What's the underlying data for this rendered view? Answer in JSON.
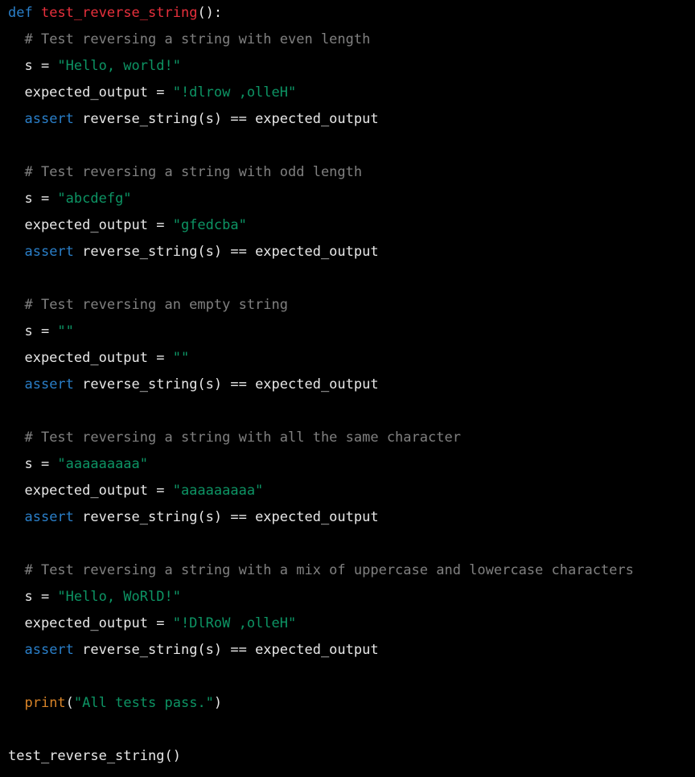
{
  "editor": {
    "language": "python",
    "background_color": "#000000",
    "default_text_color": "#e8e8e8",
    "theme_colors": {
      "keyword": "#2a7fc9",
      "function_name": "#e8303c",
      "string": "#0d9464",
      "comment": "#808080",
      "builtin": "#d98428",
      "plain": "#e8e8e8"
    }
  },
  "code": {
    "lines": [
      {
        "id": "line-1",
        "blank": false,
        "tokens": [
          {
            "t": "def",
            "k": "keyword"
          },
          {
            "t": " ",
            "k": "plain"
          },
          {
            "t": "test_reverse_string",
            "k": "funcname"
          },
          {
            "t": "():",
            "k": "punct"
          }
        ]
      },
      {
        "id": "line-2",
        "blank": false,
        "tokens": [
          {
            "t": "  ",
            "k": "plain"
          },
          {
            "t": "# Test reversing a string with even length",
            "k": "comment"
          }
        ]
      },
      {
        "id": "line-3",
        "blank": false,
        "tokens": [
          {
            "t": "  s = ",
            "k": "plain"
          },
          {
            "t": "\"Hello, world!\"",
            "k": "string"
          }
        ]
      },
      {
        "id": "line-4",
        "blank": false,
        "tokens": [
          {
            "t": "  expected_output = ",
            "k": "plain"
          },
          {
            "t": "\"!dlrow ,olleH\"",
            "k": "string"
          }
        ]
      },
      {
        "id": "line-5",
        "blank": false,
        "tokens": [
          {
            "t": "  ",
            "k": "plain"
          },
          {
            "t": "assert",
            "k": "keyword"
          },
          {
            "t": " reverse_string(s) == expected_output",
            "k": "plain"
          }
        ]
      },
      {
        "id": "line-6",
        "blank": true,
        "tokens": [
          {
            "t": " ",
            "k": "plain"
          }
        ]
      },
      {
        "id": "line-7",
        "blank": false,
        "tokens": [
          {
            "t": "  ",
            "k": "plain"
          },
          {
            "t": "# Test reversing a string with odd length",
            "k": "comment"
          }
        ]
      },
      {
        "id": "line-8",
        "blank": false,
        "tokens": [
          {
            "t": "  s = ",
            "k": "plain"
          },
          {
            "t": "\"abcdefg\"",
            "k": "string"
          }
        ]
      },
      {
        "id": "line-9",
        "blank": false,
        "tokens": [
          {
            "t": "  expected_output = ",
            "k": "plain"
          },
          {
            "t": "\"gfedcba\"",
            "k": "string"
          }
        ]
      },
      {
        "id": "line-10",
        "blank": false,
        "tokens": [
          {
            "t": "  ",
            "k": "plain"
          },
          {
            "t": "assert",
            "k": "keyword"
          },
          {
            "t": " reverse_string(s) == expected_output",
            "k": "plain"
          }
        ]
      },
      {
        "id": "line-11",
        "blank": true,
        "tokens": [
          {
            "t": " ",
            "k": "plain"
          }
        ]
      },
      {
        "id": "line-12",
        "blank": false,
        "tokens": [
          {
            "t": "  ",
            "k": "plain"
          },
          {
            "t": "# Test reversing an empty string",
            "k": "comment"
          }
        ]
      },
      {
        "id": "line-13",
        "blank": false,
        "tokens": [
          {
            "t": "  s = ",
            "k": "plain"
          },
          {
            "t": "\"\"",
            "k": "string"
          }
        ]
      },
      {
        "id": "line-14",
        "blank": false,
        "tokens": [
          {
            "t": "  expected_output = ",
            "k": "plain"
          },
          {
            "t": "\"\"",
            "k": "string"
          }
        ]
      },
      {
        "id": "line-15",
        "blank": false,
        "tokens": [
          {
            "t": "  ",
            "k": "plain"
          },
          {
            "t": "assert",
            "k": "keyword"
          },
          {
            "t": " reverse_string(s) == expected_output",
            "k": "plain"
          }
        ]
      },
      {
        "id": "line-16",
        "blank": true,
        "tokens": [
          {
            "t": " ",
            "k": "plain"
          }
        ]
      },
      {
        "id": "line-17",
        "blank": false,
        "tokens": [
          {
            "t": "  ",
            "k": "plain"
          },
          {
            "t": "# Test reversing a string with all the same character",
            "k": "comment"
          }
        ]
      },
      {
        "id": "line-18",
        "blank": false,
        "tokens": [
          {
            "t": "  s = ",
            "k": "plain"
          },
          {
            "t": "\"aaaaaaaaa\"",
            "k": "string"
          }
        ]
      },
      {
        "id": "line-19",
        "blank": false,
        "tokens": [
          {
            "t": "  expected_output = ",
            "k": "plain"
          },
          {
            "t": "\"aaaaaaaaa\"",
            "k": "string"
          }
        ]
      },
      {
        "id": "line-20",
        "blank": false,
        "tokens": [
          {
            "t": "  ",
            "k": "plain"
          },
          {
            "t": "assert",
            "k": "keyword"
          },
          {
            "t": " reverse_string(s) == expected_output",
            "k": "plain"
          }
        ]
      },
      {
        "id": "line-21",
        "blank": true,
        "tokens": [
          {
            "t": " ",
            "k": "plain"
          }
        ]
      },
      {
        "id": "line-22",
        "blank": false,
        "tokens": [
          {
            "t": "  ",
            "k": "plain"
          },
          {
            "t": "# Test reversing a string with a mix of uppercase and lowercase characters",
            "k": "comment"
          }
        ]
      },
      {
        "id": "line-23",
        "blank": false,
        "tokens": [
          {
            "t": "  s = ",
            "k": "plain"
          },
          {
            "t": "\"Hello, WoRlD!\"",
            "k": "string"
          }
        ]
      },
      {
        "id": "line-24",
        "blank": false,
        "tokens": [
          {
            "t": "  expected_output = ",
            "k": "plain"
          },
          {
            "t": "\"!DlRoW ,olleH\"",
            "k": "string"
          }
        ]
      },
      {
        "id": "line-25",
        "blank": false,
        "tokens": [
          {
            "t": "  ",
            "k": "plain"
          },
          {
            "t": "assert",
            "k": "keyword"
          },
          {
            "t": " reverse_string(s) == expected_output",
            "k": "plain"
          }
        ]
      },
      {
        "id": "line-26",
        "blank": true,
        "tokens": [
          {
            "t": " ",
            "k": "plain"
          }
        ]
      },
      {
        "id": "line-27",
        "blank": false,
        "tokens": [
          {
            "t": "  ",
            "k": "plain"
          },
          {
            "t": "print",
            "k": "builtin"
          },
          {
            "t": "(",
            "k": "punct"
          },
          {
            "t": "\"All tests pass.\"",
            "k": "string"
          },
          {
            "t": ")",
            "k": "punct"
          }
        ]
      },
      {
        "id": "line-28",
        "blank": true,
        "tokens": [
          {
            "t": " ",
            "k": "plain"
          }
        ]
      },
      {
        "id": "line-29",
        "blank": false,
        "tokens": [
          {
            "t": "test_reverse_string()",
            "k": "plain"
          }
        ]
      }
    ]
  }
}
